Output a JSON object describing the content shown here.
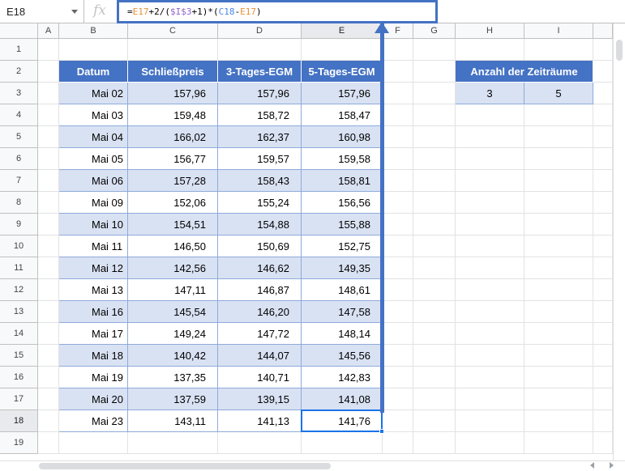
{
  "name_box": {
    "value": "E18"
  },
  "formula_bar": {
    "fx_label": "fx",
    "tokens": [
      {
        "text": "=",
        "kind": "plain"
      },
      {
        "text": "E17",
        "kind": "e17"
      },
      {
        "text": "+2/(",
        "kind": "plain"
      },
      {
        "text": "$I$3",
        "kind": "abs"
      },
      {
        "text": "+1)*(",
        "kind": "plain"
      },
      {
        "text": "C18",
        "kind": "c18"
      },
      {
        "text": "-",
        "kind": "plain"
      },
      {
        "text": "E17",
        "kind": "e17"
      },
      {
        "text": ")",
        "kind": "plain"
      }
    ]
  },
  "grid": {
    "columns": [
      "A",
      "B",
      "C",
      "D",
      "E",
      "F",
      "G",
      "H",
      "I",
      ""
    ],
    "rows": [
      "1",
      "2",
      "3",
      "4",
      "5",
      "6",
      "7",
      "8",
      "9",
      "10",
      "11",
      "12",
      "13",
      "14",
      "15",
      "16",
      "17",
      "18",
      "19"
    ],
    "selected_column": "E",
    "selected_row": "18"
  },
  "table": {
    "headers": [
      "Datum",
      "Schließpreis",
      "3-Tages-EGM",
      "5-Tages-EGM"
    ],
    "rows": [
      [
        "Mai 02",
        "157,96",
        "157,96",
        "157,96"
      ],
      [
        "Mai 03",
        "159,48",
        "158,72",
        "158,47"
      ],
      [
        "Mai 04",
        "166,02",
        "162,37",
        "160,98"
      ],
      [
        "Mai 05",
        "156,77",
        "159,57",
        "159,58"
      ],
      [
        "Mai 06",
        "157,28",
        "158,43",
        "158,81"
      ],
      [
        "Mai 09",
        "152,06",
        "155,24",
        "156,56"
      ],
      [
        "Mai 10",
        "154,51",
        "154,88",
        "155,88"
      ],
      [
        "Mai 11",
        "146,50",
        "150,69",
        "152,75"
      ],
      [
        "Mai 12",
        "142,56",
        "146,62",
        "149,35"
      ],
      [
        "Mai 13",
        "147,11",
        "146,87",
        "148,61"
      ],
      [
        "Mai 16",
        "145,54",
        "146,20",
        "147,58"
      ],
      [
        "Mai 17",
        "149,24",
        "147,72",
        "148,14"
      ],
      [
        "Mai 18",
        "140,42",
        "144,07",
        "145,56"
      ],
      [
        "Mai 19",
        "137,35",
        "140,71",
        "142,83"
      ],
      [
        "Mai 20",
        "137,59",
        "139,15",
        "141,08"
      ],
      [
        "Mai 23",
        "143,11",
        "141,13",
        "141,76"
      ]
    ]
  },
  "periods": {
    "header": "Anzahl der Zeiträume",
    "values": [
      "3",
      "5"
    ]
  },
  "colors": {
    "accent": "#4472c4",
    "band": "#d9e2f3",
    "selection": "#1a73e8"
  }
}
